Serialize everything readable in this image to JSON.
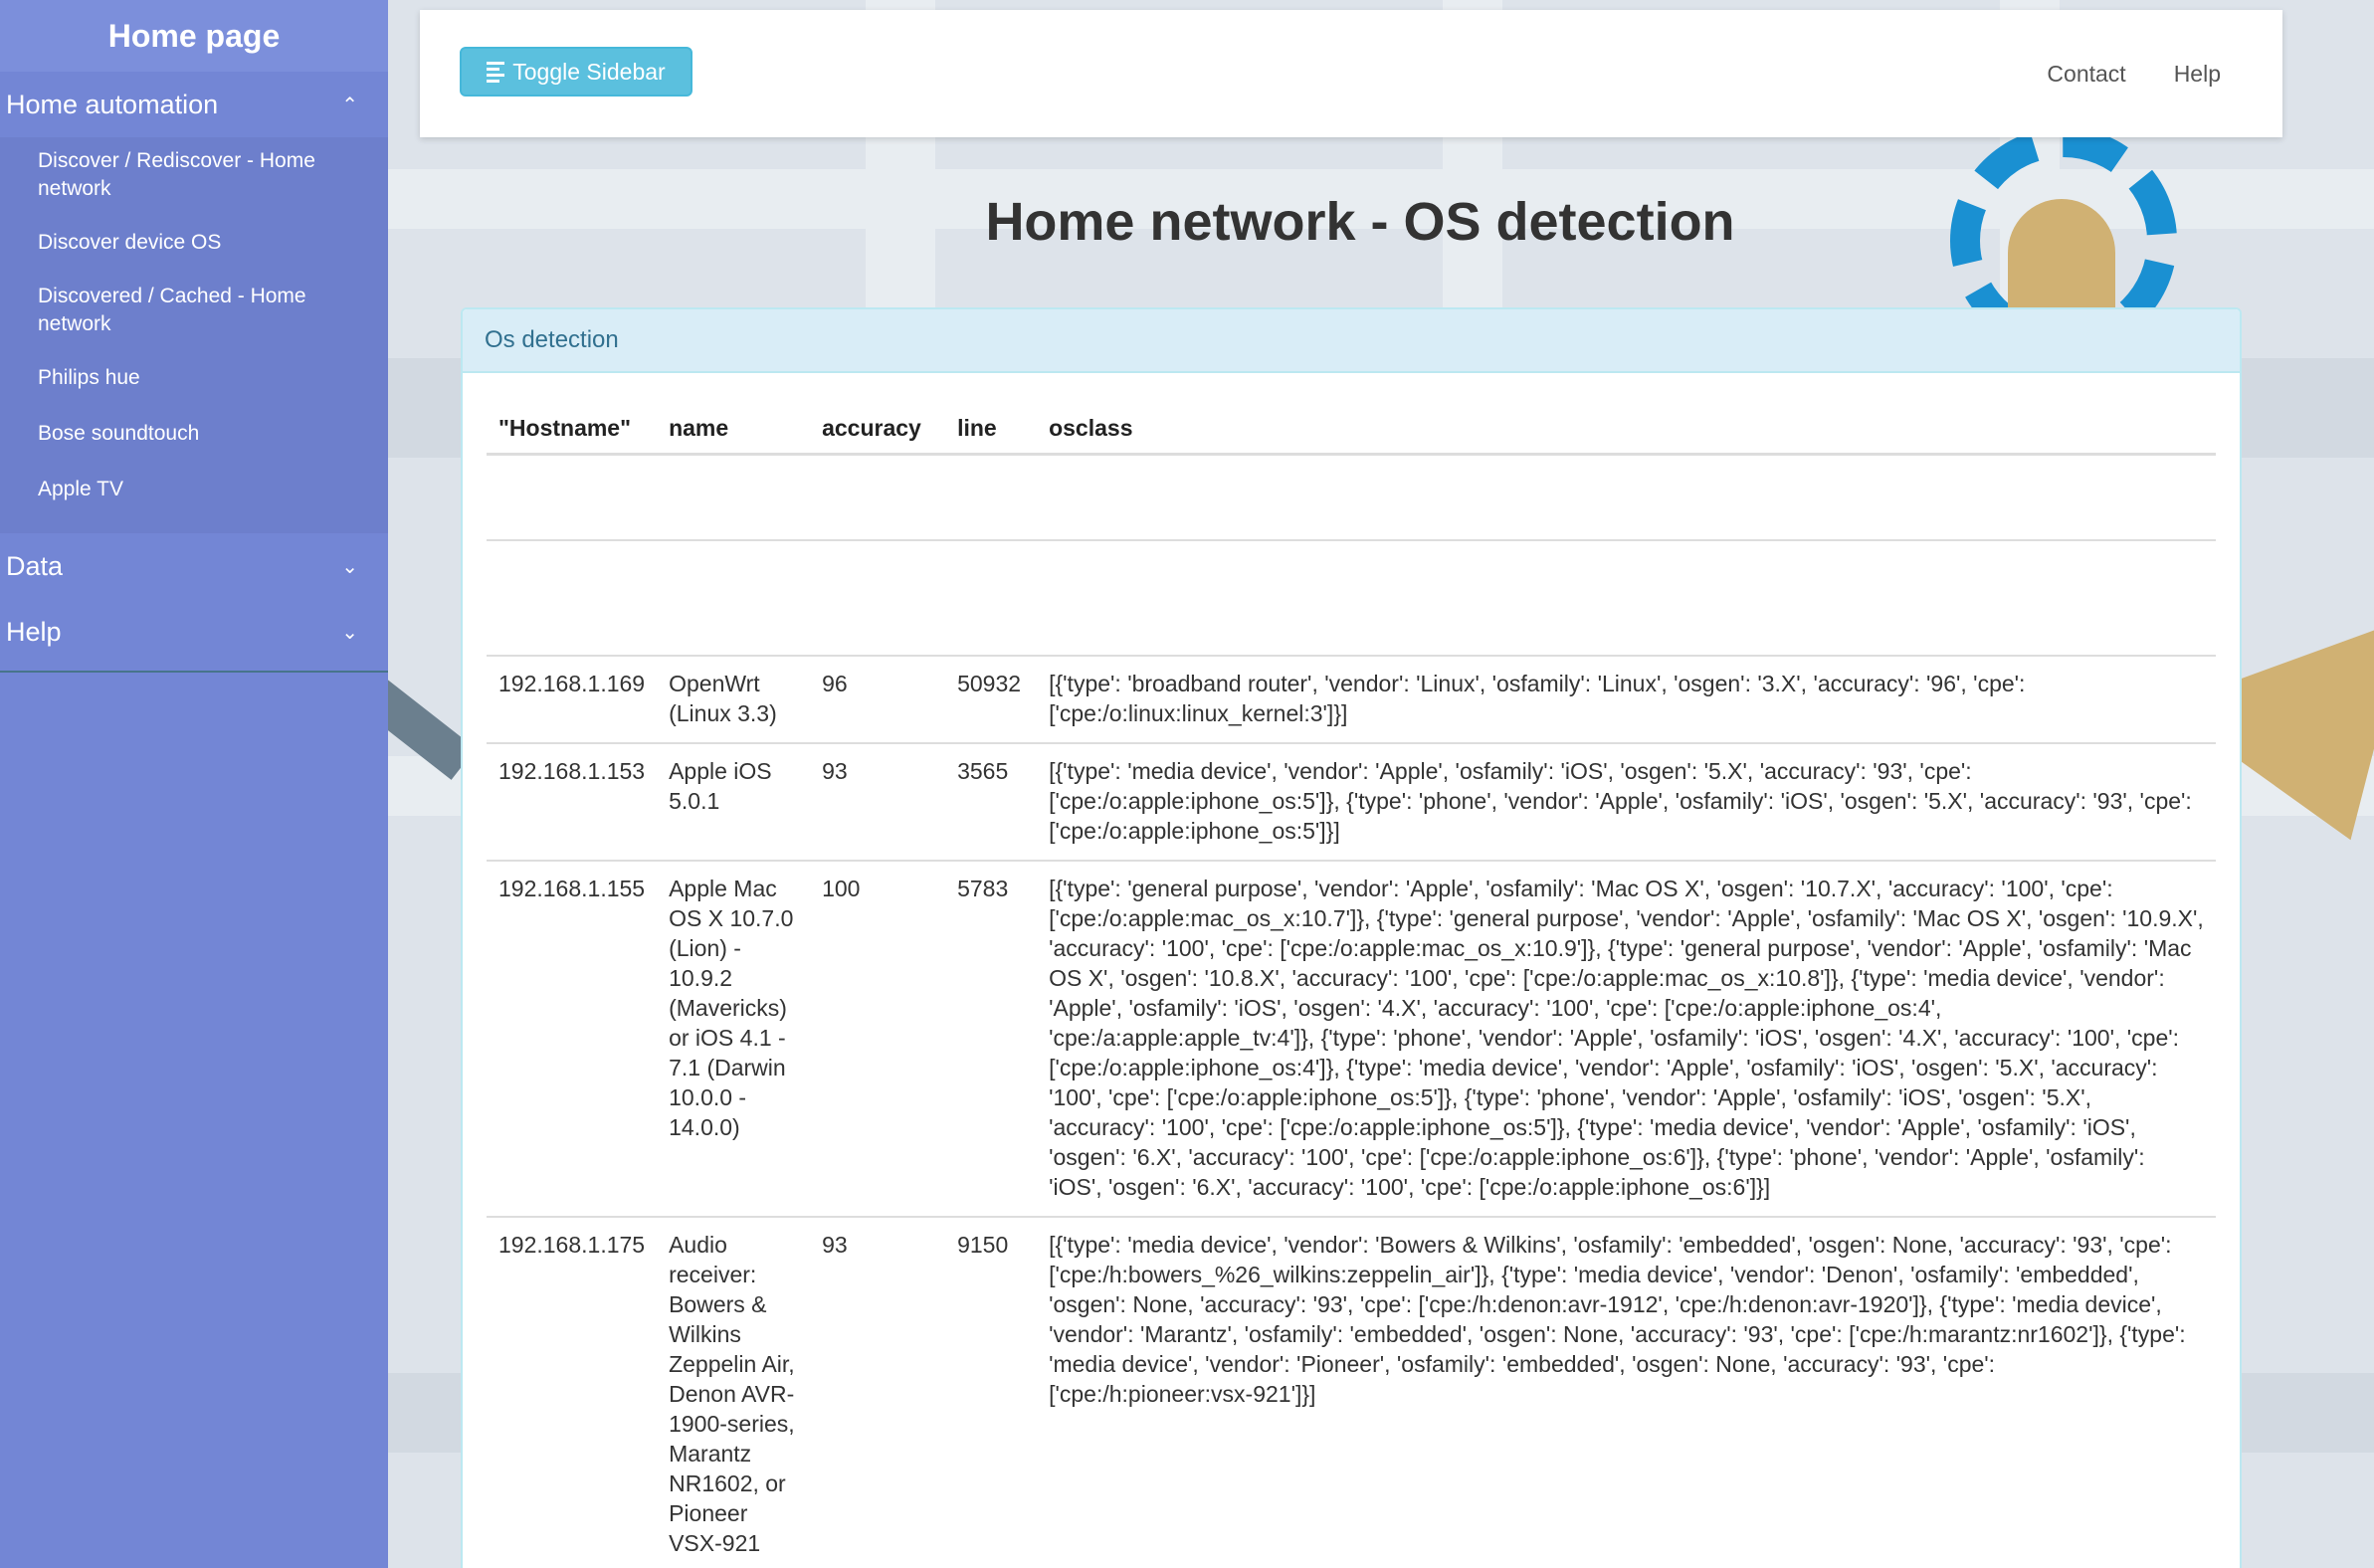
{
  "sidebar": {
    "brand": "Home page",
    "sections": [
      {
        "label": "Home automation",
        "expanded": true,
        "items": [
          "Discover / Rediscover - Home network",
          "Discover device OS",
          "Discovered / Cached - Home network",
          "Philips hue",
          "Bose soundtouch",
          "Apple TV"
        ]
      },
      {
        "label": "Data",
        "expanded": false
      },
      {
        "label": "Help",
        "expanded": false
      }
    ]
  },
  "navbar": {
    "toggle_label": "Toggle Sidebar",
    "links": [
      "Contact",
      "Help"
    ]
  },
  "page": {
    "title": "Home network - OS detection"
  },
  "panel": {
    "heading": "Os detection",
    "columns": [
      "\"Hostname\"",
      "name",
      "accuracy",
      "line",
      "osclass"
    ],
    "rows": [
      {
        "hostname": "192.168.1.169",
        "name": "OpenWrt (Linux 3.3)",
        "accuracy": "96",
        "line": "50932",
        "osclass": "[{'type': 'broadband router', 'vendor': 'Linux', 'osfamily': 'Linux', 'osgen': '3.X', 'accuracy': '96', 'cpe': ['cpe:/o:linux:linux_kernel:3']}]"
      },
      {
        "hostname": "192.168.1.153",
        "name": "Apple iOS 5.0.1",
        "accuracy": "93",
        "line": "3565",
        "osclass": "[{'type': 'media device', 'vendor': 'Apple', 'osfamily': 'iOS', 'osgen': '5.X', 'accuracy': '93', 'cpe': ['cpe:/o:apple:iphone_os:5']}, {'type': 'phone', 'vendor': 'Apple', 'osfamily': 'iOS', 'osgen': '5.X', 'accuracy': '93', 'cpe': ['cpe:/o:apple:iphone_os:5']}]"
      },
      {
        "hostname": "192.168.1.155",
        "name": "Apple Mac OS X 10.7.0 (Lion) - 10.9.2 (Mavericks) or iOS 4.1 - 7.1 (Darwin 10.0.0 - 14.0.0)",
        "accuracy": "100",
        "line": "5783",
        "osclass": "[{'type': 'general purpose', 'vendor': 'Apple', 'osfamily': 'Mac OS X', 'osgen': '10.7.X', 'accuracy': '100', 'cpe': ['cpe:/o:apple:mac_os_x:10.7']}, {'type': 'general purpose', 'vendor': 'Apple', 'osfamily': 'Mac OS X', 'osgen': '10.9.X', 'accuracy': '100', 'cpe': ['cpe:/o:apple:mac_os_x:10.9']}, {'type': 'general purpose', 'vendor': 'Apple', 'osfamily': 'Mac OS X', 'osgen': '10.8.X', 'accuracy': '100', 'cpe': ['cpe:/o:apple:mac_os_x:10.8']}, {'type': 'media device', 'vendor': 'Apple', 'osfamily': 'iOS', 'osgen': '4.X', 'accuracy': '100', 'cpe': ['cpe:/o:apple:iphone_os:4', 'cpe:/a:apple:apple_tv:4']}, {'type': 'phone', 'vendor': 'Apple', 'osfamily': 'iOS', 'osgen': '4.X', 'accuracy': '100', 'cpe': ['cpe:/o:apple:iphone_os:4']}, {'type': 'media device', 'vendor': 'Apple', 'osfamily': 'iOS', 'osgen': '5.X', 'accuracy': '100', 'cpe': ['cpe:/o:apple:iphone_os:5']}, {'type': 'phone', 'vendor': 'Apple', 'osfamily': 'iOS', 'osgen': '5.X', 'accuracy': '100', 'cpe': ['cpe:/o:apple:iphone_os:5']}, {'type': 'media device', 'vendor': 'Apple', 'osfamily': 'iOS', 'osgen': '6.X', 'accuracy': '100', 'cpe': ['cpe:/o:apple:iphone_os:6']}, {'type': 'phone', 'vendor': 'Apple', 'osfamily': 'iOS', 'osgen': '6.X', 'accuracy': '100', 'cpe': ['cpe:/o:apple:iphone_os:6']}]"
      },
      {
        "hostname": "192.168.1.175",
        "name": "Audio receiver: Bowers & Wilkins Zeppelin Air, Denon AVR-1900-series, Marantz NR1602, or Pioneer VSX-921",
        "accuracy": "93",
        "line": "9150",
        "osclass": "[{'type': 'media device', 'vendor': 'Bowers & Wilkins', 'osfamily': 'embedded', 'osgen': None, 'accuracy': '93', 'cpe': ['cpe:/h:bowers_%26_wilkins:zeppelin_air']}, {'type': 'media device', 'vendor': 'Denon', 'osfamily': 'embedded', 'osgen': None, 'accuracy': '93', 'cpe': ['cpe:/h:denon:avr-1912', 'cpe:/h:denon:avr-1920']}, {'type': 'media device', 'vendor': 'Marantz', 'osfamily': 'embedded', 'osgen': None, 'accuracy': '93', 'cpe': ['cpe:/h:marantz:nr1602']}, {'type': 'media device', 'vendor': 'Pioneer', 'osfamily': 'embedded', 'osgen': None, 'accuracy': '93', 'cpe': ['cpe:/h:pioneer:vsx-921']}]"
      }
    ]
  },
  "colors": {
    "sidebar_bg": "#7386d5",
    "toggle_btn": "#5bc0de",
    "panel_heading_bg": "#d9edf7",
    "panel_heading_text": "#31708f"
  }
}
